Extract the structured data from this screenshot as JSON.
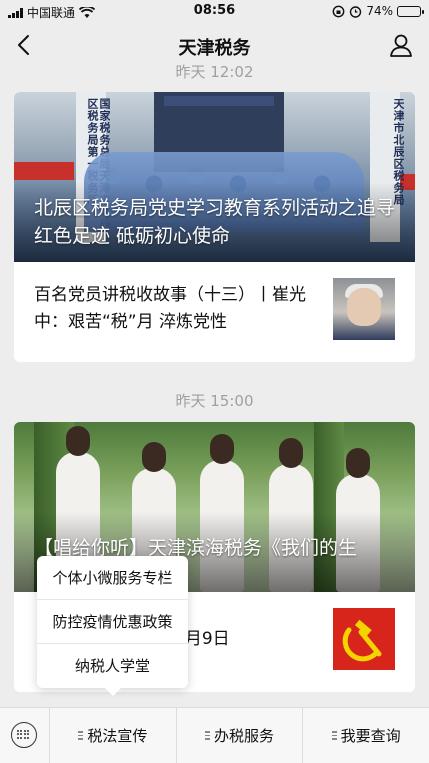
{
  "status_bar": {
    "carrier": "中国联通",
    "time": "08:56",
    "battery_percent": "74%",
    "battery_level": 0.74
  },
  "header": {
    "title": "天津税务"
  },
  "timestamps": [
    "昨天 12:02",
    "昨天 15:00"
  ],
  "card1": {
    "headline": "北辰区税务局党史学习教育系列活动之追寻红色足迹 砥砺初心使命",
    "cover_sign_left": "国家税务总局天津市北辰区税务局第一税务所",
    "cover_sign_right": "天津市北辰区税务局",
    "item_text": "百名党员讲税收故事（十三）丨崔光中：艰苦“税”月 淬炼党性"
  },
  "card2": {
    "headline": "【唱给你听】天津滨海税务《我们的生",
    "item_text": "5月9日"
  },
  "popup_menu": {
    "items": [
      "个体小微服务专栏",
      "防控疫情优惠政策",
      "纳税人学堂"
    ]
  },
  "bottom_menu": {
    "items": [
      "税法宣传",
      "办税服务",
      "我要查询"
    ]
  },
  "colors": {
    "background": "#ededed",
    "card": "#ffffff",
    "accent_red": "#d7251c"
  },
  "icons": [
    "back-arrow-icon",
    "user-icon",
    "keyboard-icon",
    "menu-mark-icon",
    "wifi-icon",
    "alarm-icon",
    "lock-rotation-icon",
    "battery-icon"
  ]
}
